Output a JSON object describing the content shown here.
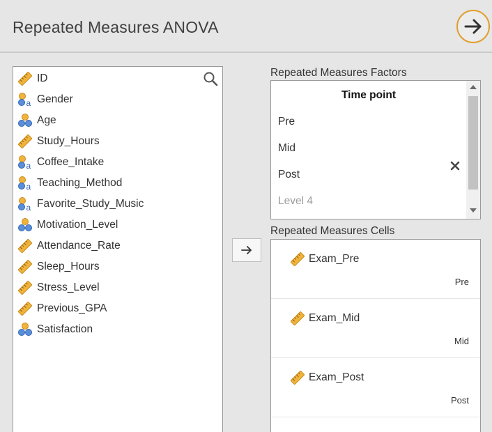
{
  "header": {
    "title": "Repeated Measures ANOVA",
    "run_icon": "arrow-right-icon"
  },
  "variables": [
    {
      "name": "ID",
      "type": "continuous"
    },
    {
      "name": "Gender",
      "type": "nominal-text"
    },
    {
      "name": "Age",
      "type": "nominal"
    },
    {
      "name": "Study_Hours",
      "type": "continuous"
    },
    {
      "name": "Coffee_Intake",
      "type": "nominal-text"
    },
    {
      "name": "Teaching_Method",
      "type": "nominal-text"
    },
    {
      "name": "Favorite_Study_Music",
      "type": "nominal-text"
    },
    {
      "name": "Motivation_Level",
      "type": "nominal"
    },
    {
      "name": "Attendance_Rate",
      "type": "continuous"
    },
    {
      "name": "Sleep_Hours",
      "type": "continuous"
    },
    {
      "name": "Stress_Level",
      "type": "continuous"
    },
    {
      "name": "Previous_GPA",
      "type": "continuous"
    },
    {
      "name": "Satisfaction",
      "type": "nominal"
    }
  ],
  "factors": {
    "label": "Repeated Measures Factors",
    "factor_name": "Time point",
    "levels": [
      "Pre",
      "Mid",
      "Post"
    ],
    "placeholder_level": "Level 4"
  },
  "cells": {
    "label": "Repeated Measures Cells",
    "items": [
      {
        "variable": "Exam_Pre",
        "level": "Pre"
      },
      {
        "variable": "Exam_Mid",
        "level": "Mid"
      },
      {
        "variable": "Exam_Post",
        "level": "Post"
      }
    ]
  },
  "colors": {
    "accent": "#e0a030",
    "ruler": "#f0b43c",
    "nominal": "#5b8fd9"
  }
}
